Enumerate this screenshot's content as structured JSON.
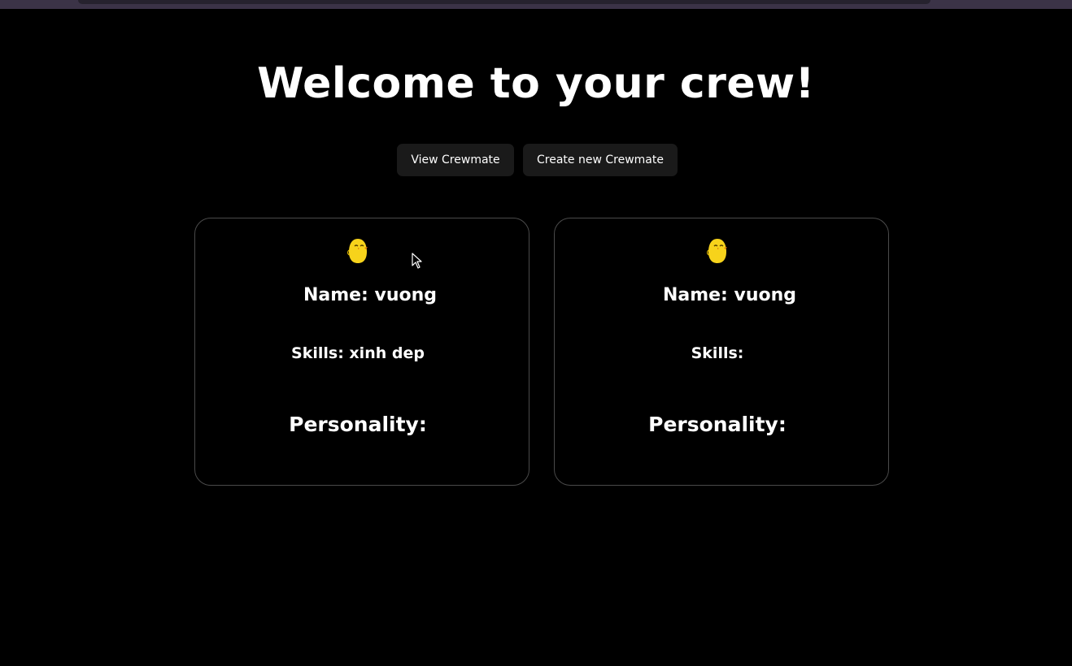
{
  "header": {
    "title": "Welcome to your crew!"
  },
  "actions": {
    "view_label": "View Crewmate",
    "create_label": "Create new Crewmate"
  },
  "crewmates": [
    {
      "avatar_icon": "yellow-chick-icon",
      "name": "Name: vuong",
      "skills": "Skills: xinh dep",
      "personality": "Personality:"
    },
    {
      "avatar_icon": "yellow-chick-icon",
      "name": "Name: vuong",
      "skills": "Skills:",
      "personality": "Personality:"
    }
  ],
  "colors": {
    "background": "#000000",
    "button_bg": "#1a1a1a",
    "card_border": "#4a4a4a",
    "avatar_yellow": "#f7d31b",
    "top_strip": "#3b3347"
  }
}
